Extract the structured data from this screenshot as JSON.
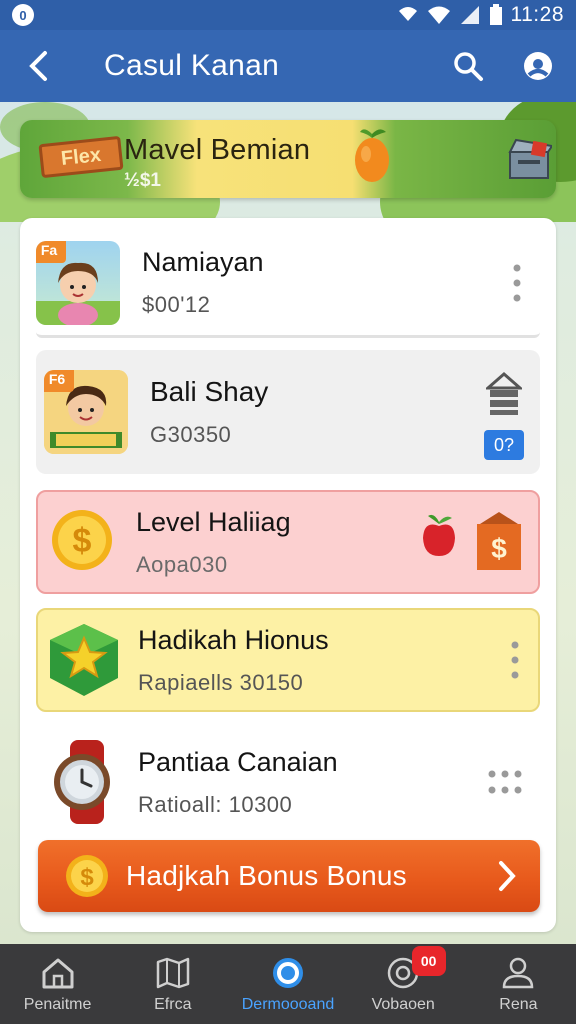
{
  "status_bar": {
    "notification": "0",
    "time": "11:28"
  },
  "app_bar": {
    "title": "Casul Kanan"
  },
  "banner": {
    "tag": "Flex",
    "title": "Mavel Bemian",
    "subtitle": "½$1"
  },
  "items": [
    {
      "title": "Namiayan",
      "sub": "$00'12",
      "badge": "Fa"
    },
    {
      "title": "Bali Shay",
      "sub": "G30350",
      "badge": "F6",
      "blue_badge": "0?"
    },
    {
      "title": "Level Haliiag",
      "sub": "Aopa030"
    },
    {
      "title": "Hadikah Hionus",
      "sub": "Rapiaells 30150"
    },
    {
      "title": "Pantiaa Canaian",
      "sub": "Ratioall: 10300"
    }
  ],
  "cta": {
    "label": "Hadjkah Bonus Bonus"
  },
  "bottom_nav": [
    {
      "label": "Penaitme",
      "icon": "home-icon"
    },
    {
      "label": "Efrca",
      "icon": "map-icon"
    },
    {
      "label": "Dermoooand",
      "icon": "circle-icon",
      "active": true
    },
    {
      "label": "Vobaoen",
      "icon": "globe-icon",
      "badge": "00"
    },
    {
      "label": "Rena",
      "icon": "profile-icon"
    }
  ],
  "colors": {
    "app_bar": "#3567b3",
    "active_nav": "#4aa3ff",
    "cta": "#e85a1c"
  }
}
